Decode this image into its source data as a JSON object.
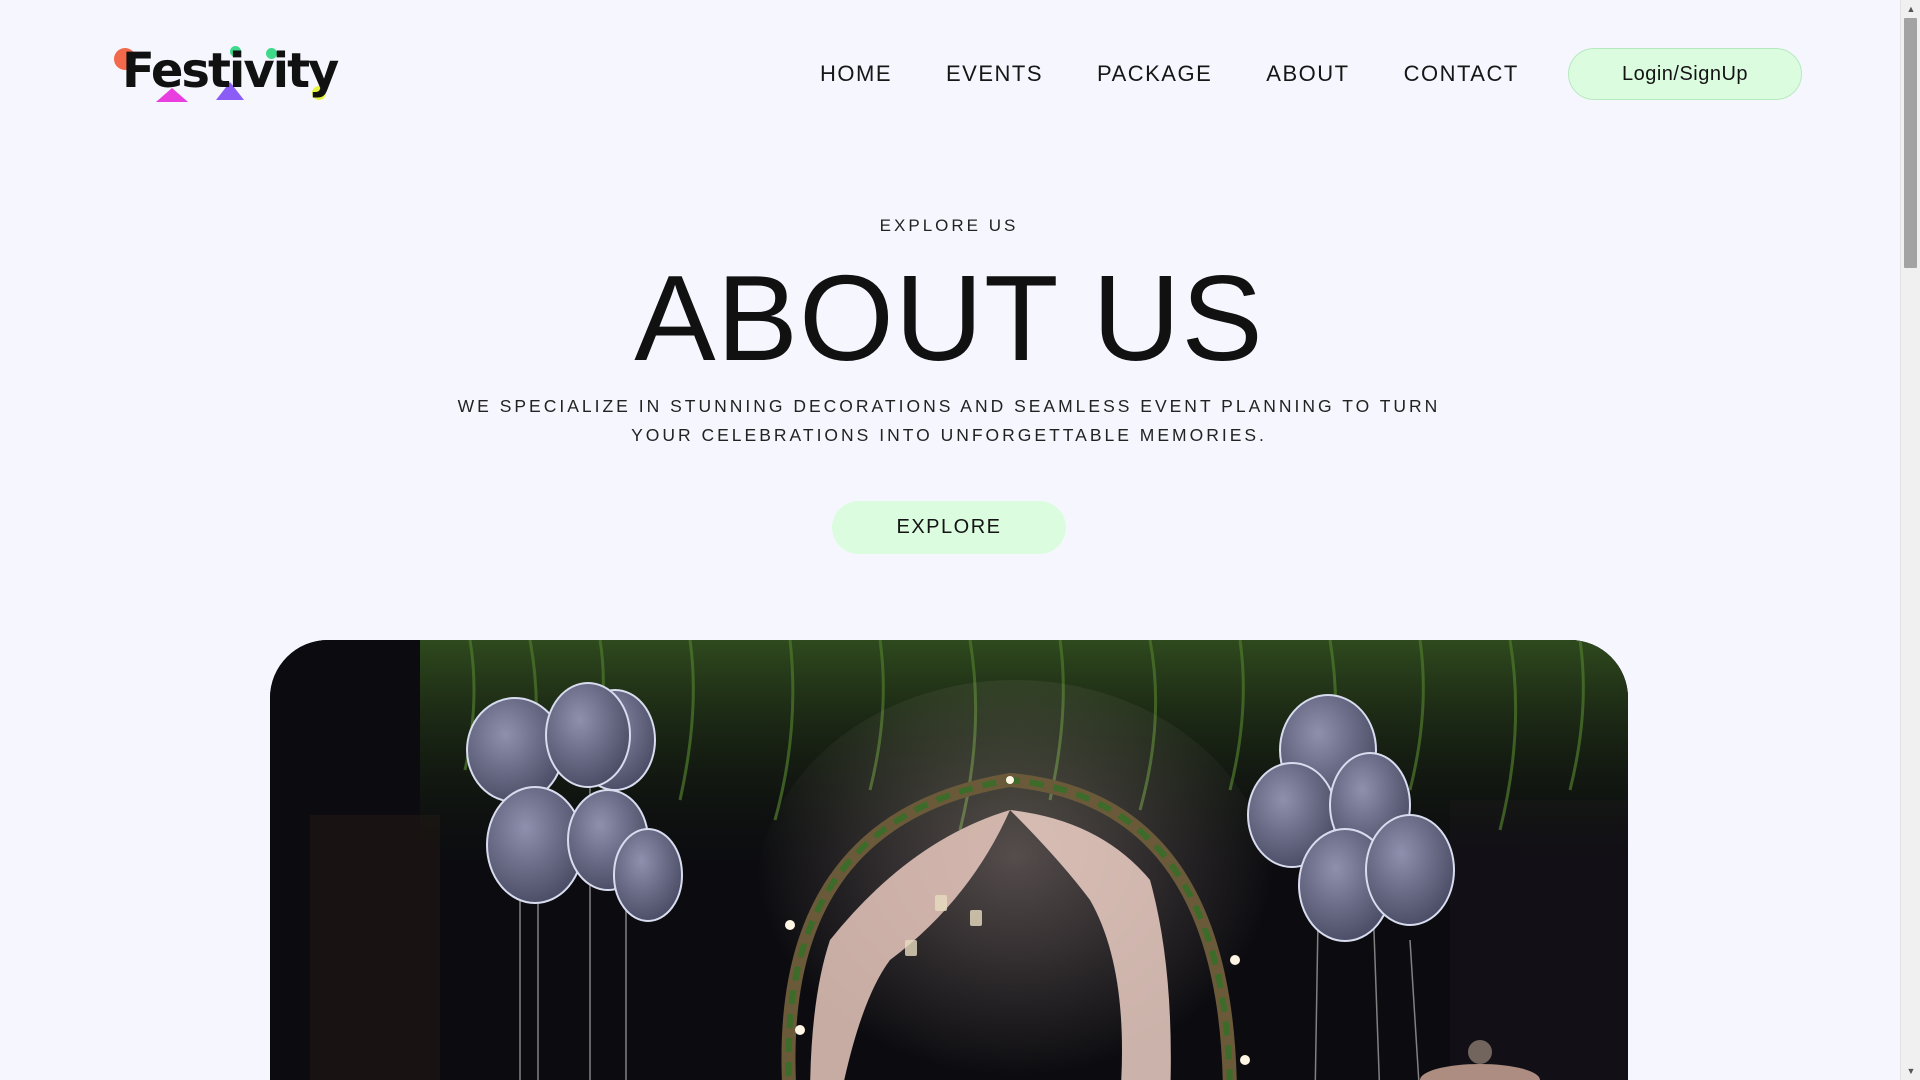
{
  "header": {
    "logo_text": "Festivity",
    "nav": [
      {
        "label": "HOME"
      },
      {
        "label": "EVENTS"
      },
      {
        "label": "PACKAGE"
      },
      {
        "label": "ABOUT"
      },
      {
        "label": "CONTACT"
      }
    ],
    "login_label": "Login/SignUp"
  },
  "hero": {
    "eyebrow": "EXPLORE US",
    "title": "ABOUT US",
    "description": "WE SPECIALIZE IN STUNNING DECORATIONS AND SEAMLESS EVENT PLANNING TO TURN YOUR CELEBRATIONS INTO UNFORGETTABLE MEMORIES.",
    "explore_label": "EXPLORE"
  },
  "photo": {
    "subject": "night-event-arch-with-balloons"
  },
  "icons": {
    "scroll_up": "scroll-up-arrow-icon",
    "scroll_down": "scroll-down-arrow-icon"
  },
  "colors": {
    "background": "#f6f7fe",
    "button_green": "#dcfce0",
    "text": "#141414",
    "logo_dot_orange": "#f26a4b",
    "logo_dot_green": "#3fd98c",
    "logo_accent_magenta": "#e83ee0",
    "logo_accent_purple": "#8b5cf6",
    "logo_accent_yellow": "#e6f542"
  }
}
